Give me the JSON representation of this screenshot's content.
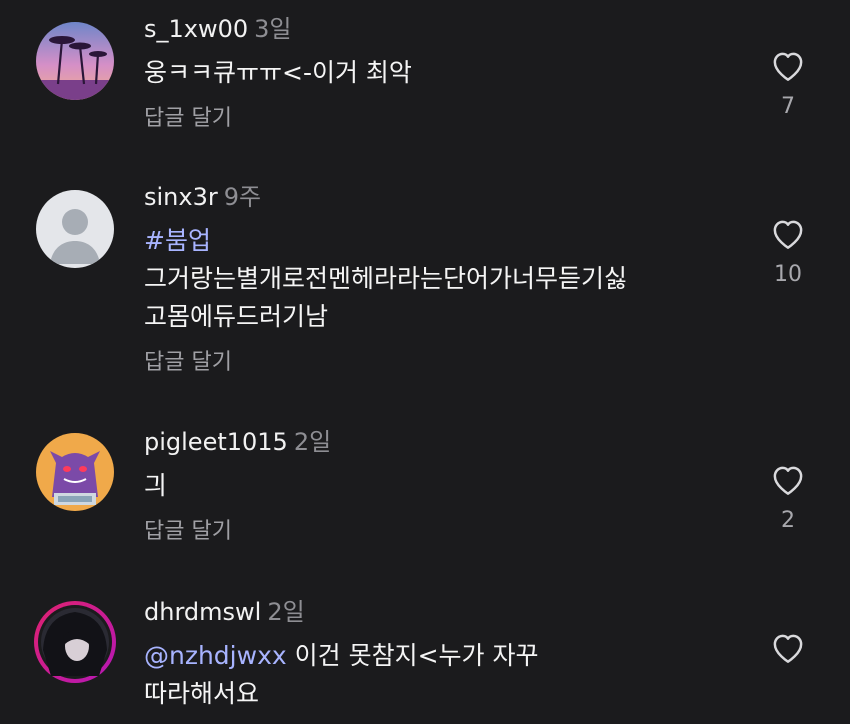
{
  "comments": [
    {
      "username": "s_1xw00",
      "time": "3일",
      "lines": [
        "웅ㅋㅋ큐ㅠㅠ<-이거 최악"
      ],
      "reply_label": "답글 달기",
      "likes": "7",
      "avatar": "palm-trees-sunset-avatar"
    },
    {
      "username": "sinx3r",
      "time": "9주",
      "hashtag": "#붐업",
      "lines": [
        "그거랑는별개로전멘헤라라는단어가너무듣기싫",
        "고몸에듀드러기남"
      ],
      "reply_label": "답글 달기",
      "likes": "10",
      "avatar": "default-user-avatar"
    },
    {
      "username": "pigleet1015",
      "time": "2일",
      "lines": [
        "긔"
      ],
      "reply_label": "답글 달기",
      "likes": "2",
      "avatar": "purple-ghost-avatar"
    },
    {
      "username": "dhrdmswl",
      "time": "2일",
      "mention": "@nzhdjwxx",
      "lines": [
        "이건 못참지<누가 자꾸",
        "따라해서요"
      ],
      "avatar": "dark-hair-story-ring-avatar"
    }
  ],
  "colors": {
    "background": "#1b1b1d",
    "mention": "#a8b4ff",
    "muted": "#8e8e93"
  }
}
